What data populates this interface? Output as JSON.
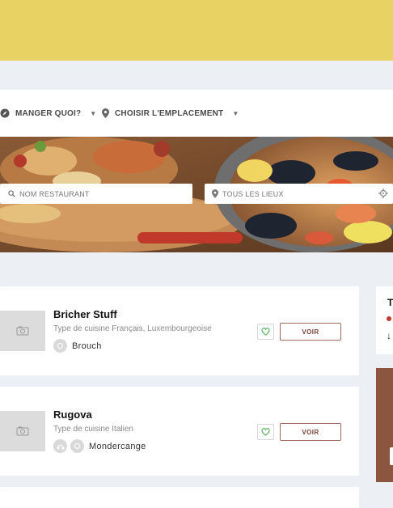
{
  "filters": {
    "cuisine_label": "MANGER QUOI?",
    "location_label": "CHOISIR L'EMPLACEMENT"
  },
  "search": {
    "name_placeholder": "NOM RESTAURANT",
    "place_placeholder": "TOUS LES LIEUX"
  },
  "restaurants": [
    {
      "name": "Bricher Stuff",
      "type": "Type de cuisine Français, Luxembourgeoise",
      "location": "Brouch",
      "button": "VOIR"
    },
    {
      "name": "Rugova",
      "type": "Type de cuisine Italien",
      "location": "Mondercange",
      "button": "VOIR"
    }
  ],
  "side": {
    "title_initial": "T",
    "arrow": "↓"
  },
  "colors": {
    "banner": "#e8d264",
    "accent": "#7b4137",
    "heart": "#4caf50"
  },
  "icons": {
    "cuisine": "compass-icon",
    "location": "map-pin-icon",
    "search": "search-icon",
    "locate": "crosshair-icon",
    "favorite": "heart-icon"
  }
}
